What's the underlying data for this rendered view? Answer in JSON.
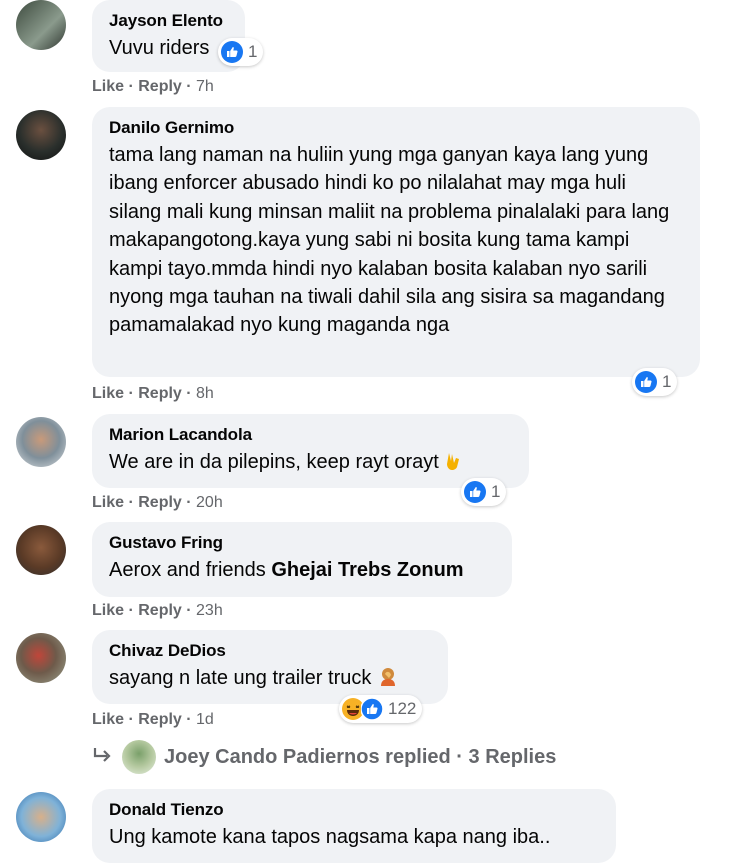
{
  "comments": [
    {
      "author": "Jayson Elento",
      "text": "Vuvu riders",
      "like": "Like",
      "reply": "Reply",
      "time": "7h",
      "reaction_count": "1"
    },
    {
      "author": "Danilo Gernimo",
      "text": "tama lang naman na huliin yung mga ganyan kaya lang yung ibang enforcer abusado hindi ko po nilalahat may mga huli silang mali kung minsan maliit na problema pinalalaki para lang makapangotong.kaya yung sabi ni bosita kung tama kampi kampi tayo.mmda hindi nyo kalaban bosita kalaban nyo sarili nyong mga tauhan na tiwali dahil sila ang sisira sa magandang pamamalakad nyo kung maganda nga",
      "like": "Like",
      "reply": "Reply",
      "time": "8h",
      "reaction_count": "1"
    },
    {
      "author": "Marion Lacandola",
      "text": "We are in da pilepins, keep rayt orayt",
      "like": "Like",
      "reply": "Reply",
      "time": "20h",
      "reaction_count": "1"
    },
    {
      "author": "Gustavo Fring",
      "text": "Aerox and friends ",
      "mention": "Ghejai Trebs Zonum",
      "like": "Like",
      "reply": "Reply",
      "time": "23h"
    },
    {
      "author": "Chivaz DeDios",
      "text": "sayang n late ung trailer truck",
      "like": "Like",
      "reply": "Reply",
      "time": "1d",
      "reaction_count": "122"
    },
    {
      "author": "Donald Tienzo",
      "text": "Ung kamote kana tapos nagsama kapa nang iba.."
    }
  ],
  "replies_row": {
    "text": "Joey Cando Padiernos replied · 3 Replies"
  },
  "sep": " · ",
  "colors": {
    "like_blue": "#1877f2",
    "haha_yellow": "#f7b125",
    "bubble": "#f0f2f5",
    "meta": "#65676b"
  },
  "icons": {
    "like": "thumbs-up-icon",
    "haha": "laughing-face-icon",
    "rock": "rock-on-hand-emoji-icon",
    "facepalm": "facepalm-emoji-icon",
    "arrow": "reply-arrow-icon"
  }
}
